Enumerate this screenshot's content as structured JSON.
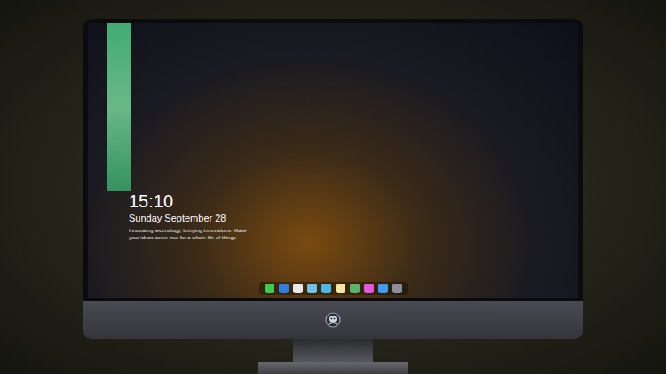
{
  "lock_screen": {
    "time": "15:10",
    "date": "Sunday September 28",
    "caption": [
      "Innovating technology, bringing innovations. Make",
      "your ideas come true for a whole life of things"
    ]
  },
  "dock": {
    "apps": [
      {
        "color": "#3ec94f"
      },
      {
        "color": "#2f7fe0"
      },
      {
        "color": "#e8e8e8"
      },
      {
        "color": "#6fc3e8"
      },
      {
        "color": "#4bb8e8"
      },
      {
        "color": "#f2e6a0"
      },
      {
        "color": "#58b56a"
      },
      {
        "color": "#e05ad8"
      },
      {
        "color": "#3d9cf0"
      },
      {
        "color": "#8a8f99"
      }
    ]
  }
}
